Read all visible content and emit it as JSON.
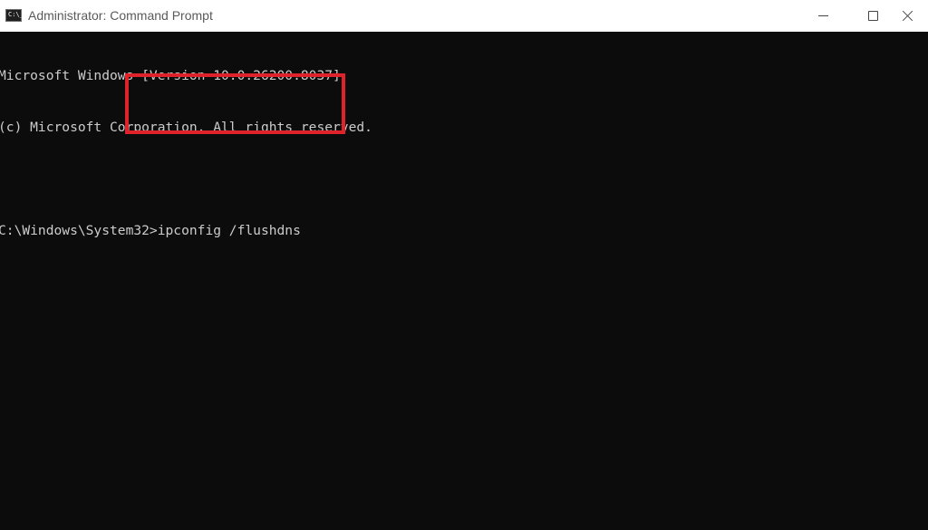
{
  "window": {
    "title": "Administrator: Command Prompt",
    "app_icon_glyph": "C:\\_",
    "icon": "command-prompt-icon"
  },
  "title_buttons": {
    "minimize": "minimize-icon",
    "maximize": "maximize-icon",
    "close": "close-icon"
  },
  "console": {
    "lines": [
      "Microsoft Windows [Version 10.0.26200.8037]",
      "(c) Microsoft Corporation. All rights reserved.",
      "",
      "C:\\Windows\\System32>ipconfig /flushdns"
    ]
  },
  "colors": {
    "background": "#0c0c0c",
    "text": "#cccccc",
    "titlebar": "#ffffff",
    "highlight": "#e0222b"
  }
}
